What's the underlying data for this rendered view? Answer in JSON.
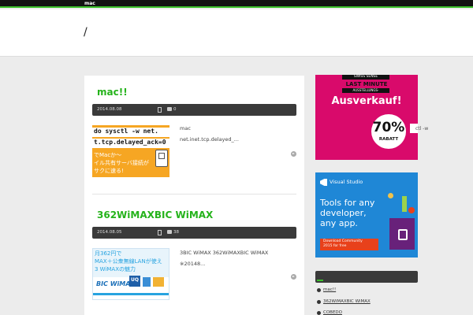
{
  "site": {
    "name": "mac",
    "logo": "/"
  },
  "posts": [
    {
      "title": "mac!!",
      "date": "2014.08.08",
      "comments": "0",
      "excerpt": [
        "mac",
        "net.inet.tcp.delayed_..."
      ],
      "thumb": {
        "line1": "do sysctl -w net.",
        "line2": "t.tcp.delayed_ack=0",
        "line3": "でMacか〜",
        "line4": "イル共有サーバ接続が",
        "line5": "サクに速る!"
      }
    },
    {
      "title": "362WiMAXBIC WiMAX",
      "date": "2014.08.05",
      "comments": "38",
      "excerpt": [
        "3BIC WiMAX  362WiMAXBIC WiMAX",
        " ※20148..."
      ],
      "thumb": {
        "line1": "月362円で",
        "line2": "MAX＋公衆無線LANが使え",
        "line3": "3 WiMAXの魅力",
        "brand": "BIC WiMAX",
        "uq": "UQ"
      }
    }
  ],
  "ads": {
    "swiss": {
      "brand": "SWISS SENSE",
      "headline": "LAST MINUTE",
      "subline": "AUSSTELLUNGS-",
      "main": "Ausverkauf!",
      "percent": "70%",
      "label": "RABATT"
    },
    "vs": {
      "product": "Visual Studio",
      "tagline": [
        "Tools for any",
        "developer,",
        "any app."
      ],
      "cta": [
        "Download Community",
        "2015 for free"
      ]
    }
  },
  "sidebar": {
    "overflow_text": "ctl -w",
    "recent": [
      "mac!!",
      "362WiMAXBIC WiMAX",
      "COBEDO"
    ]
  },
  "colors": {
    "accent": "#3bbf2b",
    "title": "#25b31b",
    "meta_bar": "#3a3a3a"
  }
}
